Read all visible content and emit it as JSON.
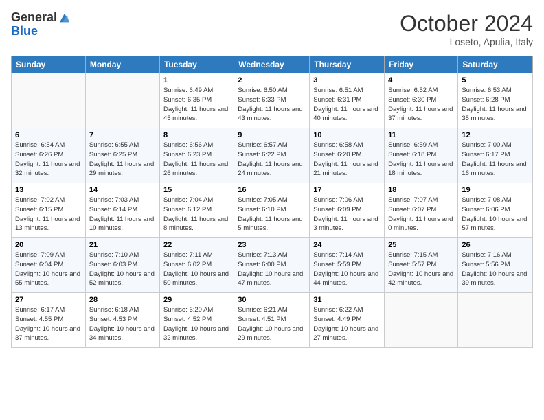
{
  "header": {
    "logo_general": "General",
    "logo_blue": "Blue",
    "month_title": "October 2024",
    "subtitle": "Loseto, Apulia, Italy"
  },
  "days_of_week": [
    "Sunday",
    "Monday",
    "Tuesday",
    "Wednesday",
    "Thursday",
    "Friday",
    "Saturday"
  ],
  "weeks": [
    [
      {
        "day": "",
        "info": ""
      },
      {
        "day": "",
        "info": ""
      },
      {
        "day": "1",
        "info": "Sunrise: 6:49 AM\nSunset: 6:35 PM\nDaylight: 11 hours and 45 minutes."
      },
      {
        "day": "2",
        "info": "Sunrise: 6:50 AM\nSunset: 6:33 PM\nDaylight: 11 hours and 43 minutes."
      },
      {
        "day": "3",
        "info": "Sunrise: 6:51 AM\nSunset: 6:31 PM\nDaylight: 11 hours and 40 minutes."
      },
      {
        "day": "4",
        "info": "Sunrise: 6:52 AM\nSunset: 6:30 PM\nDaylight: 11 hours and 37 minutes."
      },
      {
        "day": "5",
        "info": "Sunrise: 6:53 AM\nSunset: 6:28 PM\nDaylight: 11 hours and 35 minutes."
      }
    ],
    [
      {
        "day": "6",
        "info": "Sunrise: 6:54 AM\nSunset: 6:26 PM\nDaylight: 11 hours and 32 minutes."
      },
      {
        "day": "7",
        "info": "Sunrise: 6:55 AM\nSunset: 6:25 PM\nDaylight: 11 hours and 29 minutes."
      },
      {
        "day": "8",
        "info": "Sunrise: 6:56 AM\nSunset: 6:23 PM\nDaylight: 11 hours and 26 minutes."
      },
      {
        "day": "9",
        "info": "Sunrise: 6:57 AM\nSunset: 6:22 PM\nDaylight: 11 hours and 24 minutes."
      },
      {
        "day": "10",
        "info": "Sunrise: 6:58 AM\nSunset: 6:20 PM\nDaylight: 11 hours and 21 minutes."
      },
      {
        "day": "11",
        "info": "Sunrise: 6:59 AM\nSunset: 6:18 PM\nDaylight: 11 hours and 18 minutes."
      },
      {
        "day": "12",
        "info": "Sunrise: 7:00 AM\nSunset: 6:17 PM\nDaylight: 11 hours and 16 minutes."
      }
    ],
    [
      {
        "day": "13",
        "info": "Sunrise: 7:02 AM\nSunset: 6:15 PM\nDaylight: 11 hours and 13 minutes."
      },
      {
        "day": "14",
        "info": "Sunrise: 7:03 AM\nSunset: 6:14 PM\nDaylight: 11 hours and 10 minutes."
      },
      {
        "day": "15",
        "info": "Sunrise: 7:04 AM\nSunset: 6:12 PM\nDaylight: 11 hours and 8 minutes."
      },
      {
        "day": "16",
        "info": "Sunrise: 7:05 AM\nSunset: 6:10 PM\nDaylight: 11 hours and 5 minutes."
      },
      {
        "day": "17",
        "info": "Sunrise: 7:06 AM\nSunset: 6:09 PM\nDaylight: 11 hours and 3 minutes."
      },
      {
        "day": "18",
        "info": "Sunrise: 7:07 AM\nSunset: 6:07 PM\nDaylight: 11 hours and 0 minutes."
      },
      {
        "day": "19",
        "info": "Sunrise: 7:08 AM\nSunset: 6:06 PM\nDaylight: 10 hours and 57 minutes."
      }
    ],
    [
      {
        "day": "20",
        "info": "Sunrise: 7:09 AM\nSunset: 6:04 PM\nDaylight: 10 hours and 55 minutes."
      },
      {
        "day": "21",
        "info": "Sunrise: 7:10 AM\nSunset: 6:03 PM\nDaylight: 10 hours and 52 minutes."
      },
      {
        "day": "22",
        "info": "Sunrise: 7:11 AM\nSunset: 6:02 PM\nDaylight: 10 hours and 50 minutes."
      },
      {
        "day": "23",
        "info": "Sunrise: 7:13 AM\nSunset: 6:00 PM\nDaylight: 10 hours and 47 minutes."
      },
      {
        "day": "24",
        "info": "Sunrise: 7:14 AM\nSunset: 5:59 PM\nDaylight: 10 hours and 44 minutes."
      },
      {
        "day": "25",
        "info": "Sunrise: 7:15 AM\nSunset: 5:57 PM\nDaylight: 10 hours and 42 minutes."
      },
      {
        "day": "26",
        "info": "Sunrise: 7:16 AM\nSunset: 5:56 PM\nDaylight: 10 hours and 39 minutes."
      }
    ],
    [
      {
        "day": "27",
        "info": "Sunrise: 6:17 AM\nSunset: 4:55 PM\nDaylight: 10 hours and 37 minutes."
      },
      {
        "day": "28",
        "info": "Sunrise: 6:18 AM\nSunset: 4:53 PM\nDaylight: 10 hours and 34 minutes."
      },
      {
        "day": "29",
        "info": "Sunrise: 6:20 AM\nSunset: 4:52 PM\nDaylight: 10 hours and 32 minutes."
      },
      {
        "day": "30",
        "info": "Sunrise: 6:21 AM\nSunset: 4:51 PM\nDaylight: 10 hours and 29 minutes."
      },
      {
        "day": "31",
        "info": "Sunrise: 6:22 AM\nSunset: 4:49 PM\nDaylight: 10 hours and 27 minutes."
      },
      {
        "day": "",
        "info": ""
      },
      {
        "day": "",
        "info": ""
      }
    ]
  ]
}
